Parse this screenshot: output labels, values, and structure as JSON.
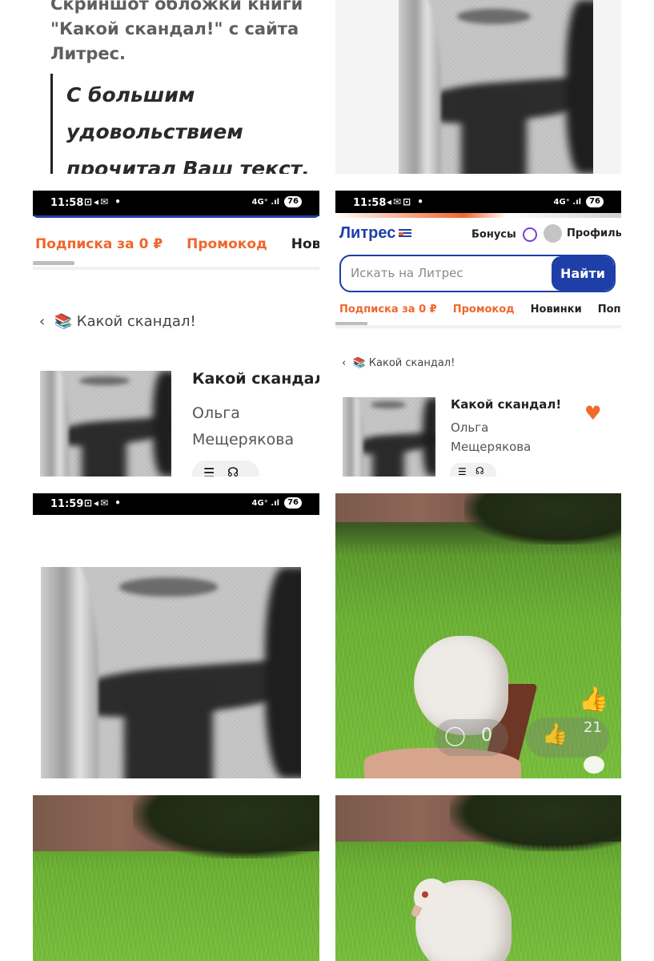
{
  "article": {
    "text": "Скриншот обложки книги \"Какой скандал!\" с сайта Литрес.",
    "quote": "С большим удовольствием прочитал Ваш текст."
  },
  "status_bars": [
    {
      "time": "11:58",
      "notif": "⊡◂✉ •",
      "network": "4G⁺ .ıl",
      "battery": "76"
    },
    {
      "time": "11:58",
      "notif": "◂✉⊡ •",
      "network": "4G⁺ .ıl",
      "battery": "76"
    },
    {
      "time": "11:59",
      "notif": "⊡◂✉ •",
      "network": "4G⁺ .ıl",
      "battery": "76"
    }
  ],
  "litres": {
    "logo": "Литрес",
    "bonuses": "Бонусы",
    "profile": "Профиль",
    "search_placeholder": "Искать на Литрес",
    "search_button": "Найти",
    "tabs_large": [
      "Подписка за 0 ₽",
      "Промокод",
      "Нови"
    ],
    "tabs_small": [
      "Подписка за 0 ₽",
      "Промокод",
      "Новинки",
      "Популя"
    ]
  },
  "book": {
    "breadcrumb": "📚 Какой скандал!",
    "title_cut": "Какой скандал",
    "title": "Какой скандал!",
    "author_first": "Ольга",
    "author_last": "Мещерякова"
  },
  "reactions": {
    "comments": "0",
    "likes": "21"
  },
  "colors": {
    "accent": "#f0662a",
    "brand": "#1f3fa8"
  }
}
